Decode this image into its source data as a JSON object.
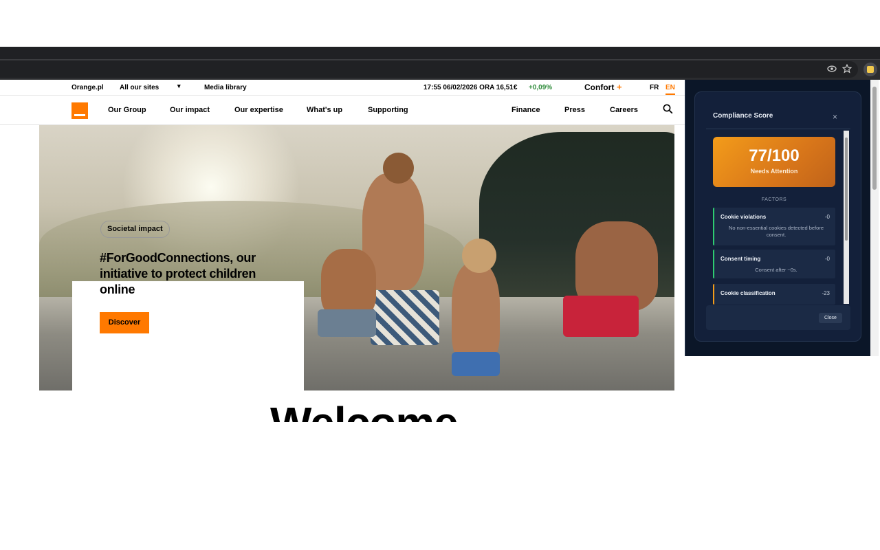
{
  "browser": {
    "icons": [
      "eye-icon",
      "star-icon",
      "extension-icon"
    ]
  },
  "utility_bar": {
    "orange_pl": "Orange.pl",
    "all_sites": "All our sites",
    "media_library": "Media library",
    "stock": "17:55 06/02/2026 ORA 16,51€",
    "stock_change": "+0,09%",
    "confort": "Confort",
    "confort_plus": "+",
    "lang_fr": "FR",
    "lang_en": "EN"
  },
  "nav": {
    "items": [
      "Our Group",
      "Our impact",
      "Our expertise",
      "What's up",
      "Supporting"
    ],
    "right_items": [
      "Finance",
      "Press",
      "Careers"
    ]
  },
  "hero": {
    "badge": "Societal impact",
    "headline": "#ForGoodConnections, our initiative to protect children online",
    "cta": "Discover"
  },
  "welcome": "Welcome",
  "popup": {
    "title": "Compliance Score",
    "close_x": "×",
    "score": "77/100",
    "status": "Needs Attention",
    "factors_label": "FACTORS",
    "factors": [
      {
        "name": "Cookie violations",
        "value": "-0",
        "desc": "No non-essential cookies detected before consent."
      },
      {
        "name": "Consent timing",
        "value": "-0",
        "desc": "Consent after ~0s."
      },
      {
        "name": "Cookie classification",
        "value": "-23",
        "desc": ""
      }
    ],
    "close_button": "Close"
  },
  "colors": {
    "brand_orange": "#ff7900",
    "positive_green": "#2e8b3a",
    "popup_bg": "#0b1628",
    "score_orange": "#f39c1a"
  }
}
